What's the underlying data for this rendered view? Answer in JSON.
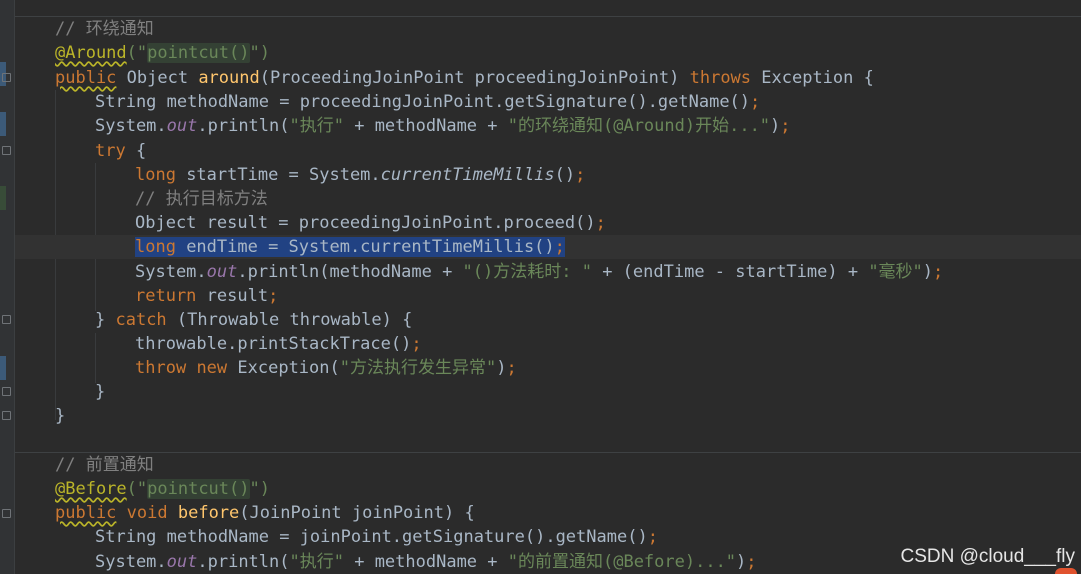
{
  "editor": {
    "language": "java",
    "lines": [
      {
        "segments": [
          {
            "t": "// 环绕通知",
            "c": "cmt"
          }
        ]
      },
      {
        "segments": [
          {
            "t": "@Around",
            "c": "ann squig"
          },
          {
            "t": "(\"",
            "c": "str"
          },
          {
            "t": "pointcut()",
            "c": "str pcbox"
          },
          {
            "t": "\")",
            "c": "str"
          }
        ]
      },
      {
        "segments": [
          {
            "t": "public",
            "c": "kw squig"
          },
          {
            "t": " Object ",
            "c": ""
          },
          {
            "t": "around",
            "c": "fn"
          },
          {
            "t": "(ProceedingJoinPoint proceedingJoinPoint) ",
            "c": ""
          },
          {
            "t": "throws",
            "c": "kw"
          },
          {
            "t": " Exception {",
            "c": ""
          }
        ]
      },
      {
        "segments": [
          {
            "t": "String methodName = proceedingJoinPoint.getSignature().getName()",
            "c": ""
          },
          {
            "t": ";",
            "c": "kw"
          }
        ]
      },
      {
        "segments": [
          {
            "t": "System.",
            "c": ""
          },
          {
            "t": "out",
            "c": "fld"
          },
          {
            "t": ".println(",
            "c": ""
          },
          {
            "t": "\"执行\"",
            "c": "str"
          },
          {
            "t": " + methodName + ",
            "c": ""
          },
          {
            "t": "\"的环绕通知(@Around)开始...\"",
            "c": "str"
          },
          {
            "t": ")",
            "c": ""
          },
          {
            "t": ";",
            "c": "kw"
          }
        ]
      },
      {
        "segments": [
          {
            "t": "try",
            "c": "kw"
          },
          {
            "t": " {",
            "c": ""
          }
        ]
      },
      {
        "segments": [
          {
            "t": "long",
            "c": "kw"
          },
          {
            "t": " startTime = System.",
            "c": ""
          },
          {
            "t": "currentTimeMillis",
            "c": "ital"
          },
          {
            "t": "()",
            "c": ""
          },
          {
            "t": ";",
            "c": "kw"
          }
        ]
      },
      {
        "segments": [
          {
            "t": "// 执行目标方法",
            "c": "cmt"
          }
        ]
      },
      {
        "segments": [
          {
            "t": "Object result = proceedingJoinPoint.proceed()",
            "c": ""
          },
          {
            "t": ";",
            "c": "kw"
          }
        ]
      },
      {
        "segments": [
          {
            "t": "long",
            "c": "kw sel"
          },
          {
            "t": " endTime = System.currentTimeMillis()",
            "c": "sel"
          },
          {
            "t": ";",
            "c": "kw sel"
          }
        ]
      },
      {
        "segments": [
          {
            "t": "System.",
            "c": ""
          },
          {
            "t": "out",
            "c": "fld"
          },
          {
            "t": ".println(methodName + ",
            "c": ""
          },
          {
            "t": "\"()方法耗时: \"",
            "c": "str"
          },
          {
            "t": " + (endTime - startTime) + ",
            "c": ""
          },
          {
            "t": "\"毫秒\"",
            "c": "str"
          },
          {
            "t": ")",
            "c": ""
          },
          {
            "t": ";",
            "c": "kw"
          }
        ]
      },
      {
        "segments": [
          {
            "t": "return",
            "c": "kw"
          },
          {
            "t": " result",
            "c": ""
          },
          {
            "t": ";",
            "c": "kw"
          }
        ]
      },
      {
        "segments": [
          {
            "t": "} ",
            "c": ""
          },
          {
            "t": "catch",
            "c": "kw"
          },
          {
            "t": " (Throwable throwable) {",
            "c": ""
          }
        ]
      },
      {
        "segments": [
          {
            "t": "throwable.printStackTrace()",
            "c": ""
          },
          {
            "t": ";",
            "c": "kw"
          }
        ]
      },
      {
        "segments": [
          {
            "t": "throw",
            "c": "kw"
          },
          {
            "t": " ",
            "c": ""
          },
          {
            "t": "new",
            "c": "kw"
          },
          {
            "t": " Exception(",
            "c": ""
          },
          {
            "t": "\"方法执行发生异常\"",
            "c": "str"
          },
          {
            "t": ")",
            "c": ""
          },
          {
            "t": ";",
            "c": "kw"
          }
        ]
      },
      {
        "segments": [
          {
            "t": "}",
            "c": ""
          }
        ]
      },
      {
        "segments": [
          {
            "t": "}",
            "c": ""
          }
        ]
      },
      {
        "segments": []
      },
      {
        "segments": [
          {
            "t": "// 前置通知",
            "c": "cmt"
          }
        ]
      },
      {
        "segments": [
          {
            "t": "@Before",
            "c": "ann squig"
          },
          {
            "t": "(\"",
            "c": "str"
          },
          {
            "t": "pointcut()",
            "c": "str pcbox"
          },
          {
            "t": "\")",
            "c": "str"
          }
        ]
      },
      {
        "segments": [
          {
            "t": "public",
            "c": "kw squig"
          },
          {
            "t": " ",
            "c": ""
          },
          {
            "t": "void",
            "c": "kw"
          },
          {
            "t": " ",
            "c": ""
          },
          {
            "t": "before",
            "c": "fn"
          },
          {
            "t": "(JoinPoint joinPoint) {",
            "c": ""
          }
        ]
      },
      {
        "segments": [
          {
            "t": "String methodName = joinPoint.getSignature().getName()",
            "c": ""
          },
          {
            "t": ";",
            "c": "kw"
          }
        ]
      },
      {
        "segments": [
          {
            "t": "System.",
            "c": ""
          },
          {
            "t": "out",
            "c": "fld"
          },
          {
            "t": ".println(",
            "c": ""
          },
          {
            "t": "\"执行\"",
            "c": "str"
          },
          {
            "t": " + methodName + ",
            "c": ""
          },
          {
            "t": "\"的前置通知(@Before)...\"",
            "c": "str"
          },
          {
            "t": ")",
            "c": ""
          },
          {
            "t": ";",
            "c": "kw"
          }
        ]
      }
    ]
  },
  "watermark": {
    "text": "CSDN @cloud___fly"
  },
  "colors": {
    "background": "#2b2b2b",
    "keyword": "#cc7832",
    "annotation": "#bbb529",
    "string": "#6a8759",
    "comment": "#808080",
    "method_declaration": "#ffc66d",
    "static_field": "#9876aa",
    "selection": "#214283",
    "default_text": "#a9b7c6"
  }
}
